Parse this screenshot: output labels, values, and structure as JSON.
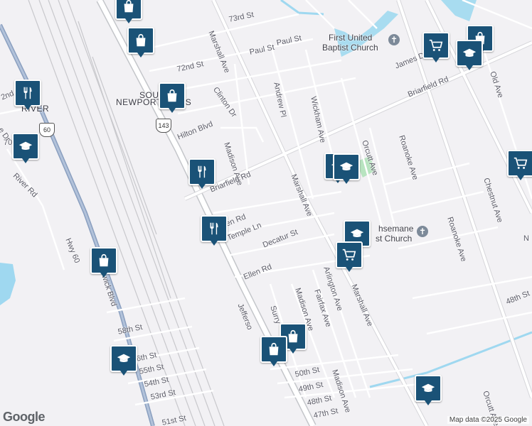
{
  "map": {
    "attribution": "Map data ©2025 Google",
    "logo": "Google",
    "places": [
      {
        "text": "SOUTH",
        "css": "left:196px;top:127px;"
      },
      {
        "text": "NEWPORT NEWS",
        "css": "left:163px;top:137px;"
      },
      {
        "text": "RIVER",
        "css": "left:30px;top:146px;"
      }
    ],
    "pois": [
      {
        "text": "First United",
        "css": "left:462px;top:46px;"
      },
      {
        "text": "Baptist Church",
        "css": "left:453px;top:60px;"
      },
      {
        "text": "hsemane",
        "css": "left:532px;top:315px;"
      },
      {
        "text": "st Church",
        "css": "left:528px;top:329px;"
      }
    ],
    "streets": [
      {
        "text": "73rd St",
        "css": "left:322px;top:22px;transform:rotate(-12deg);"
      },
      {
        "text": "Paul St",
        "css": "left:351px;top:68px;transform:rotate(-12deg);"
      },
      {
        "text": "Paul St",
        "css": "left:389px;top:55px;transform:rotate(-12deg);"
      },
      {
        "text": "72nd St",
        "css": "left:249px;top:92px;transform:rotate(-12deg);"
      },
      {
        "text": "Clinton Dr",
        "css": "left:302px;top:118px;transform:rotate(55deg);"
      },
      {
        "text": "Andrew Pl",
        "css": "left:388px;top:110px;transform:rotate(78deg);"
      },
      {
        "text": "Wickham Ave",
        "css": "left:440px;top:130px;transform:rotate(78deg);"
      },
      {
        "text": "James Dr",
        "css": "left:556px;top:88px;transform:rotate(-22deg);"
      },
      {
        "text": "Briarfield Rd",
        "css": "left:574px;top:128px;transform:rotate(-22deg);"
      },
      {
        "text": "Old Ave",
        "css": "left:692px;top:95px;transform:rotate(72deg);"
      },
      {
        "text": "Marshall Ave",
        "css": "left:296px;top:38px;transform:rotate(68deg);"
      },
      {
        "text": "Hilton Blvd",
        "css": "left:250px;top:188px;transform:rotate(-22deg);"
      },
      {
        "text": "Madison Ave",
        "css": "left:318px;top:195px;transform:rotate(72deg);"
      },
      {
        "text": "Orcutt Ave",
        "css": "left:512px;top:192px;transform:rotate(72deg);"
      },
      {
        "text": "Roanoke Ave",
        "css": "left:564px;top:185px;transform:rotate(72deg);"
      },
      {
        "text": "Chestnut Ave",
        "css": "left:683px;top:245px;transform:rotate(72deg);"
      },
      {
        "text": "Briarfield Rd",
        "css": "left:296px;top:262px;transform:rotate(-22deg);"
      },
      {
        "text": "Marshall Ave",
        "css": "left:412px;top:240px;transform:rotate(68deg);"
      },
      {
        "text": "Roanoke Ave",
        "css": "left:632px;top:300px;transform:rotate(72deg);"
      },
      {
        "text": "56",
        "css": "left:730px;top:240px;"
      },
      {
        "text": "N",
        "css": "left:736px;top:330px;"
      },
      {
        "text": "en Rd",
        "css": "left:318px;top:310px;transform:rotate(-22deg);"
      },
      {
        "text": "Temple Ln",
        "css": "left:320px;top:330px;transform:rotate(-22deg);"
      },
      {
        "text": "Decatur St",
        "css": "left:370px;top:340px;transform:rotate(-22deg);"
      },
      {
        "text": "Ellen Rd",
        "css": "left:343px;top:385px;transform:rotate(-22deg);"
      },
      {
        "text": "Madison Ave",
        "css": "left:418px;top:400px;transform:rotate(72deg);"
      },
      {
        "text": "Fairfax Ave",
        "css": "left:445px;top:402px;transform:rotate(72deg);"
      },
      {
        "text": "Arlington Ave",
        "css": "left:458px;top:370px;transform:rotate(72deg);"
      },
      {
        "text": "Marshall Ave",
        "css": "left:497px;top:395px;transform:rotate(68deg);"
      },
      {
        "text": "Surry",
        "css": "left:383px;top:425px;transform:rotate(72deg);"
      },
      {
        "text": "Jefferso",
        "css": "left:337px;top:422px;transform:rotate(68deg);"
      },
      {
        "text": "48th St",
        "css": "left:712px;top:420px;transform:rotate(-22deg);"
      },
      {
        "text": "Hwy 60",
        "css": "left:95px;top:330px;transform:rotate(68deg);"
      },
      {
        "text": "rwick Blvd",
        "css": "left:145px;top:378px;transform:rotate(72deg);"
      },
      {
        "text": "River Rd",
        "css": "left:20px;top:240px;transform:rotate(45deg);"
      },
      {
        "text": "58th St",
        "css": "left:166px;top:462px;transform:rotate(-12deg);"
      },
      {
        "text": "6th St",
        "css": "left:192px;top:500px;transform:rotate(-12deg);"
      },
      {
        "text": "55th St",
        "css": "left:196px;top:518px;transform:rotate(-12deg);"
      },
      {
        "text": "54th St",
        "css": "left:203px;top:536px;transform:rotate(-12deg);"
      },
      {
        "text": "53rd St",
        "css": "left:212px;top:554px;transform:rotate(-12deg);"
      },
      {
        "text": "51st St",
        "css": "left:228px;top:590px;transform:rotate(-12deg);"
      },
      {
        "text": "50th St",
        "css": "left:415px;top:522px;transform:rotate(-12deg);"
      },
      {
        "text": "49th St",
        "css": "left:420px;top:543px;transform:rotate(-12deg);"
      },
      {
        "text": "48th St",
        "css": "left:432px;top:562px;transform:rotate(-12deg);"
      },
      {
        "text": "47th St",
        "css": "left:441px;top:580px;transform:rotate(-12deg);"
      },
      {
        "text": "Madison Ave",
        "css": "left:470px;top:515px;transform:rotate(72deg);"
      },
      {
        "text": "Orcutt Ave",
        "css": "left:682px;top:545px;transform:rotate(72deg);"
      },
      {
        "text": "2nd",
        "css": "left:2px;top:132px;transform:rotate(-22deg);"
      },
      {
        "text": "70",
        "css": "left:5px;top:195px;"
      },
      {
        "text": "e Dr",
        "css": "left:0px;top:175px;transform:rotate(55deg);"
      }
    ],
    "route_shields": [
      {
        "text": "143",
        "css": "left:219px;top:167px;"
      },
      {
        "text": "60",
        "css": "left:55px;top:173px;"
      }
    ]
  }
}
